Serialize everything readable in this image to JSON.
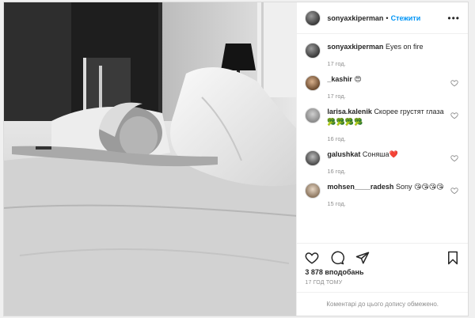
{
  "header": {
    "username": "sonyaxkiperman",
    "separator": "•",
    "follow_label": "Стежити",
    "more_label": "•••"
  },
  "caption": {
    "username": "sonyaxkiperman",
    "text": "Eyes on fire",
    "time": "17 год."
  },
  "comments": [
    {
      "username": "_kashir",
      "text": "😍",
      "time": "17 год."
    },
    {
      "username": "larisa.kalenik",
      "text": "Скорее грустят глаза 🥦🥦🥦🥦",
      "time": "16 год."
    },
    {
      "username": "galushkat",
      "text": "Соняша❤️",
      "time": "16 год."
    },
    {
      "username": "mohsen____radesh",
      "text": "Sony 😘😘😘😘",
      "time": "15 год."
    }
  ],
  "actions": {
    "like_icon": "heart-outline-icon",
    "comment_icon": "comment-bubble-icon",
    "share_icon": "paper-plane-icon",
    "save_icon": "bookmark-icon"
  },
  "likes_text": "3 878 вподобань",
  "posted_ago": "17 ГОД ТОМУ",
  "footer_text": "Коментарі до цього допису обмежено.",
  "colors": {
    "follow": "#0095f6",
    "muted": "#8e8e8e",
    "heart": "#e0245e"
  }
}
